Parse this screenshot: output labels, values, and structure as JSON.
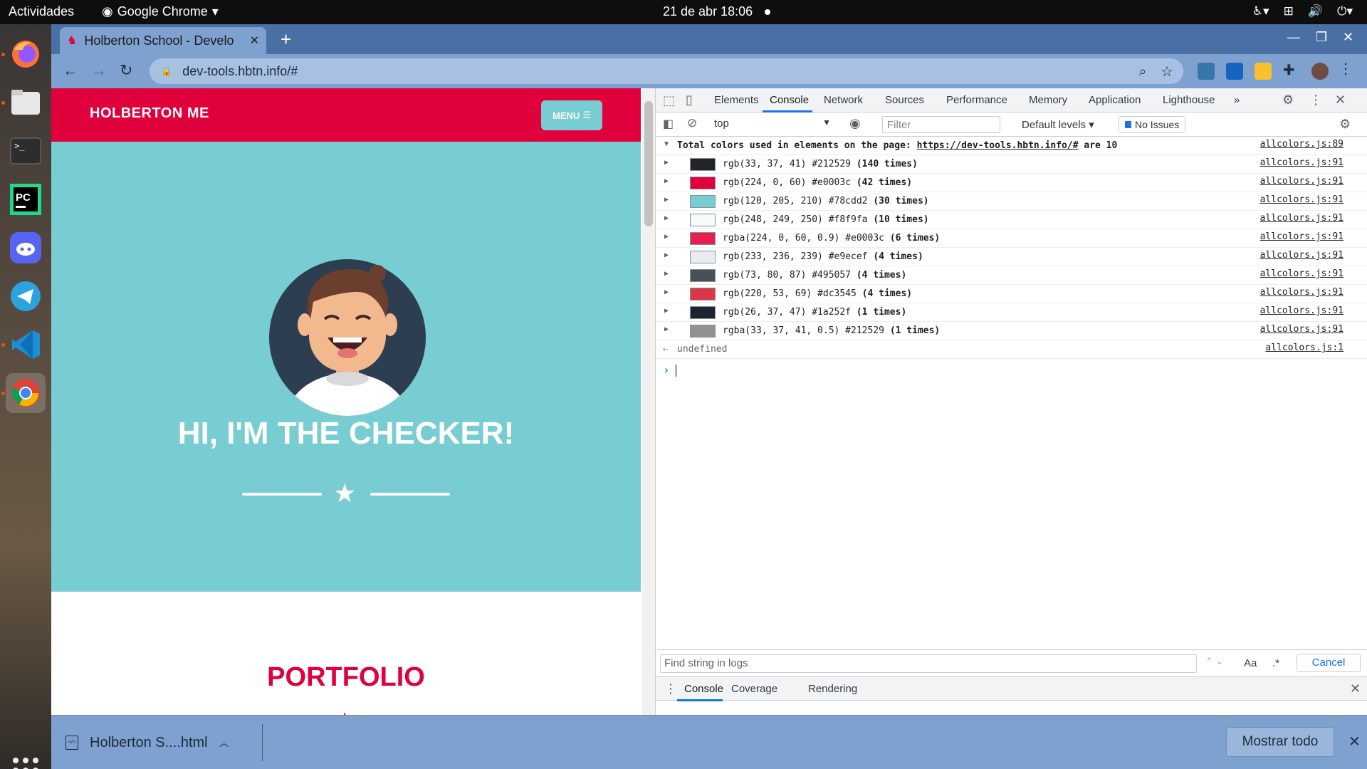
{
  "topbar": {
    "activities": "Actividades",
    "app_name": "Google Chrome",
    "clock": "21 de abr  18:06"
  },
  "dock": {
    "apps": [
      "firefox",
      "files",
      "terminal",
      "pycharm",
      "discord",
      "telegram",
      "vscode",
      "chrome",
      "show-applications"
    ]
  },
  "browser": {
    "tab_title": "Holberton School - Develo",
    "url": "dev-tools.hbtn.info/#",
    "accent": "#4a6fa5"
  },
  "page": {
    "brand": "HOLBERTON ME",
    "menu_label": "MENU",
    "heading": "HI, I'M THE CHECKER!",
    "portfolio": "PORTFOLIO",
    "colors": {
      "primary": "#e0003c",
      "secondary": "#78cdd2",
      "dark": "#2c3e50"
    }
  },
  "devtools": {
    "tabs": [
      "Elements",
      "Console",
      "Network",
      "Sources",
      "Performance",
      "Memory",
      "Application",
      "Lighthouse"
    ],
    "active_tab": "Console",
    "more_tabs": "»",
    "context": "top",
    "filter_placeholder": "Filter",
    "levels": "Default levels",
    "issues": "No Issues",
    "console": {
      "header": {
        "prefix": "Total colors used in elements on the page:",
        "link": "https://dev-tools.hbtn.info/#",
        "suffix": "are 10",
        "source": "allcolors.js:89"
      },
      "rows": [
        {
          "value": "rgb(33, 37, 41) #212529",
          "count": "(140 times)",
          "swatch": "#212529",
          "source": "allcolors.js:91"
        },
        {
          "value": "rgb(224, 0, 60) #e0003c",
          "count": "(42 times)",
          "swatch": "#e0003c",
          "source": "allcolors.js:91"
        },
        {
          "value": "rgb(120, 205, 210) #78cdd2",
          "count": "(30 times)",
          "swatch": "#78cdd2",
          "source": "allcolors.js:91"
        },
        {
          "value": "rgb(248, 249, 250) #f8f9fa",
          "count": "(10 times)",
          "swatch": "#f8f9fa",
          "source": "allcolors.js:91"
        },
        {
          "value": "rgba(224, 0, 60, 0.9) #e0003c",
          "count": "(6 times)",
          "swatch": "#e61f50",
          "source": "allcolors.js:91"
        },
        {
          "value": "rgb(233, 236, 239) #e9ecef",
          "count": "(4 times)",
          "swatch": "#e9ecef",
          "source": "allcolors.js:91"
        },
        {
          "value": "rgb(73, 80, 87) #495057",
          "count": "(4 times)",
          "swatch": "#495057",
          "source": "allcolors.js:91"
        },
        {
          "value": "rgb(220, 53, 69) #dc3545",
          "count": "(4 times)",
          "swatch": "#dc3545",
          "source": "allcolors.js:91"
        },
        {
          "value": "rgb(26, 37, 47) #1a252f",
          "count": "(1 times)",
          "swatch": "#1a252f",
          "source": "allcolors.js:91"
        },
        {
          "value": "rgba(33, 37, 41, 0.5) #212529",
          "count": "(1 times)",
          "swatch": "#909294",
          "source": "allcolors.js:91"
        }
      ],
      "return_value": "undefined",
      "return_source": "allcolors.js:1"
    },
    "find": {
      "placeholder": "Find string in logs",
      "case_label": "Aa",
      "regex_label": ".*",
      "cancel": "Cancel"
    },
    "drawer_tabs": [
      "Console",
      "Coverage",
      "Rendering"
    ]
  },
  "downloads": {
    "file_name": "Holberton S....html",
    "show_all": "Mostrar todo"
  }
}
